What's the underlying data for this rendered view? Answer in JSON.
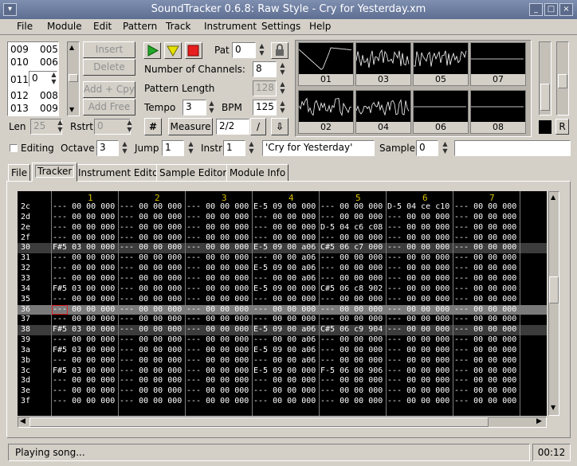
{
  "window": {
    "title": "SoundTracker 0.6.8: Raw Style - Cry for Yesterday.xm"
  },
  "menu": [
    "File",
    "Module",
    "Edit",
    "Pattern",
    "Track",
    "Instrument",
    "Settings",
    "Help"
  ],
  "order_list": [
    [
      "009",
      "005"
    ],
    [
      "010",
      "006"
    ],
    [
      "011",
      "0"
    ],
    [
      "012",
      "008"
    ],
    [
      "013",
      "009"
    ]
  ],
  "order_buttons": {
    "insert": "Insert",
    "delete": "Delete",
    "add_cpy": "Add + Cpy",
    "add_free": "Add Free"
  },
  "len": {
    "label": "Len",
    "value": "25"
  },
  "rstrt": {
    "label": "Rstrt",
    "value": "0"
  },
  "pat": {
    "label": "Pat",
    "value": "0"
  },
  "channels": {
    "label": "Number of Channels:",
    "value": "8"
  },
  "pattern_length": {
    "label": "Pattern Length",
    "value": "128"
  },
  "tempo": {
    "label": "Tempo",
    "value": "3"
  },
  "bpm": {
    "label": "BPM",
    "value": "125"
  },
  "measure": {
    "sharp": "#",
    "label": "Measure",
    "value": "2/2"
  },
  "scopes": [
    "01",
    "03",
    "05",
    "07",
    "02",
    "04",
    "06",
    "08"
  ],
  "r_button": "R",
  "editing": "Editing",
  "octave": {
    "label": "Octave",
    "value": "3"
  },
  "jump": {
    "label": "Jump",
    "value": "1"
  },
  "instr": {
    "label": "Instr",
    "value": "1",
    "name": "'Cry for Yesterday'"
  },
  "sample": {
    "label": "Sample",
    "value": "0",
    "name": ""
  },
  "tabs": [
    "File",
    "Tracker",
    "Instrument Editor",
    "Sample Editor",
    "Module Info"
  ],
  "tracker": {
    "channel_headers": [
      "1",
      "2",
      "3",
      "4",
      "5",
      "6",
      "7"
    ],
    "rows": [
      {
        "num": "2c",
        "cells": [
          "--- 00 00 000",
          "--- 00 00 000",
          "--- 00 00 000",
          "E-5 09 00 000",
          "--- 00 00 000",
          "D-5 04 ce c10",
          "--- 00 00 000"
        ]
      },
      {
        "num": "2d",
        "cells": [
          "--- 00 00 000",
          "--- 00 00 000",
          "--- 00 00 000",
          "--- 00 00 000",
          "--- 00 00 000",
          "--- 00 00 000",
          "--- 00 00 000"
        ]
      },
      {
        "num": "2e",
        "cells": [
          "--- 00 00 000",
          "--- 00 00 000",
          "--- 00 00 000",
          "--- 00 00 000",
          "D-5 04 c6 c08",
          "--- 00 00 000",
          "--- 00 00 000"
        ]
      },
      {
        "num": "2f",
        "cells": [
          "--- 00 00 000",
          "--- 00 00 000",
          "--- 00 00 000",
          "--- 00 00 000",
          "--- 00 00 000",
          "--- 00 00 000",
          "--- 00 00 000"
        ]
      },
      {
        "num": "30",
        "cells": [
          "F#5 03 00 000",
          "--- 00 00 000",
          "--- 00 00 000",
          "E-5 09 00 a06",
          "C#5 06 c7 000",
          "--- 00 00 000",
          "--- 00 00 000"
        ]
      },
      {
        "num": "31",
        "cells": [
          "--- 00 00 000",
          "--- 00 00 000",
          "--- 00 00 000",
          "--- 00 00 a06",
          "--- 00 00 000",
          "--- 00 00 000",
          "--- 00 00 000"
        ]
      },
      {
        "num": "32",
        "cells": [
          "--- 00 00 000",
          "--- 00 00 000",
          "--- 00 00 000",
          "E-5 09 00 a06",
          "--- 00 00 000",
          "--- 00 00 000",
          "--- 00 00 000"
        ]
      },
      {
        "num": "33",
        "cells": [
          "--- 00 00 000",
          "--- 00 00 000",
          "--- 00 00 000",
          "--- 00 00 a06",
          "--- 00 00 000",
          "--- 00 00 000",
          "--- 00 00 000"
        ]
      },
      {
        "num": "34",
        "cells": [
          "F#5 03 00 000",
          "--- 00 00 000",
          "--- 00 00 000",
          "E-5 09 00 000",
          "C#5 06 c8 902",
          "--- 00 00 000",
          "--- 00 00 000"
        ]
      },
      {
        "num": "35",
        "cells": [
          "--- 00 00 000",
          "--- 00 00 000",
          "--- 00 00 000",
          "--- 00 00 000",
          "--- 00 00 000",
          "--- 00 00 000",
          "--- 00 00 000"
        ]
      },
      {
        "num": "36",
        "cells": [
          "--- 00 00 000",
          "--- 00 00 000",
          "--- 00 00 000",
          "--- 00 00 000",
          "--- 00 00 000",
          "--- 00 00 000",
          "--- 00 00 000"
        ]
      },
      {
        "num": "37",
        "cells": [
          "--- 00 00 000",
          "--- 00 00 000",
          "--- 00 00 000",
          "--- 00 00 000",
          "--- 00 00 000",
          "--- 00 00 000",
          "--- 00 00 000"
        ]
      },
      {
        "num": "38",
        "cells": [
          "F#5 03 00 000",
          "--- 00 00 000",
          "--- 00 00 000",
          "E-5 09 00 a06",
          "C#5 06 c9 904",
          "--- 00 00 000",
          "--- 00 00 000"
        ]
      },
      {
        "num": "39",
        "cells": [
          "--- 00 00 000",
          "--- 00 00 000",
          "--- 00 00 000",
          "--- 00 00 a06",
          "--- 00 00 000",
          "--- 00 00 000",
          "--- 00 00 000"
        ]
      },
      {
        "num": "3a",
        "cells": [
          "F#5 03 00 000",
          "--- 00 00 000",
          "--- 00 00 000",
          "E-5 09 00 a06",
          "--- 00 00 000",
          "--- 00 00 000",
          "--- 00 00 000"
        ]
      },
      {
        "num": "3b",
        "cells": [
          "--- 00 00 000",
          "--- 00 00 000",
          "--- 00 00 000",
          "--- 00 00 a06",
          "--- 00 00 000",
          "--- 00 00 000",
          "--- 00 00 000"
        ]
      },
      {
        "num": "3c",
        "cells": [
          "F#5 03 00 000",
          "--- 00 00 000",
          "--- 00 00 000",
          "E-5 09 00 000",
          "F-5 06 00 906",
          "--- 00 00 000",
          "--- 00 00 000"
        ]
      },
      {
        "num": "3d",
        "cells": [
          "--- 00 00 000",
          "--- 00 00 000",
          "--- 00 00 000",
          "--- 00 00 000",
          "--- 00 00 000",
          "--- 00 00 000",
          "--- 00 00 000"
        ]
      },
      {
        "num": "3e",
        "cells": [
          "--- 00 00 000",
          "--- 00 00 000",
          "--- 00 00 000",
          "--- 00 00 000",
          "--- 00 00 000",
          "--- 00 00 000",
          "--- 00 00 000"
        ]
      },
      {
        "num": "3f",
        "cells": [
          "--- 00 00 000",
          "--- 00 00 000",
          "--- 00 00 000",
          "--- 00 00 000",
          "--- 00 00 000",
          "--- 00 00 000",
          "--- 00 00 000"
        ]
      }
    ]
  },
  "status": {
    "text": "Playing song...",
    "time": "00:12"
  }
}
